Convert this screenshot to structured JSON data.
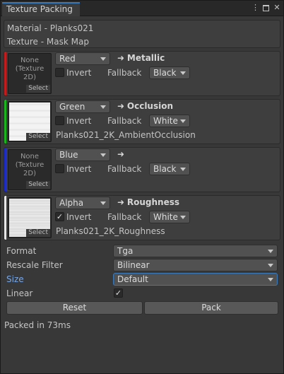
{
  "window": {
    "tab_title": "Texture Packing",
    "icons": [
      "kebab-menu-icon",
      "maximize-icon",
      "close-icon"
    ]
  },
  "info": {
    "material": "Material - Planks021",
    "texture": "Texture - Mask Map"
  },
  "channels": [
    {
      "strip_color": "#c41c1c",
      "slot_text": "None\n(Texture\n2D)",
      "slot_has_texture": false,
      "source": "Red",
      "target": "Metallic",
      "invert_label": "Invert",
      "invert_checked": false,
      "fallback_label": "Fallback",
      "fallback": "Black",
      "texture_name": ""
    },
    {
      "strip_color": "#1cb41c",
      "slot_text": "",
      "slot_has_texture": true,
      "source": "Green",
      "target": "Occlusion",
      "invert_label": "Invert",
      "invert_checked": false,
      "fallback_label": "Fallback",
      "fallback": "White",
      "texture_name": "Planks021_2K_AmbientOcclusion"
    },
    {
      "strip_color": "#1c2cc4",
      "slot_text": "None\n(Texture\n2D)",
      "slot_has_texture": false,
      "source": "Blue",
      "target": "",
      "invert_label": "Invert",
      "invert_checked": false,
      "fallback_label": "Fallback",
      "fallback": "Black",
      "texture_name": ""
    },
    {
      "strip_color": "#e6e6e6",
      "slot_text": "",
      "slot_has_texture": true,
      "source": "Alpha",
      "target": "Roughness",
      "invert_label": "Invert",
      "invert_checked": true,
      "fallback_label": "Fallback",
      "fallback": "White",
      "texture_name": "Planks021_2K_Roughness"
    }
  ],
  "slot_select_label": "Select",
  "arrow_glyph": "➜",
  "settings": {
    "format_label": "Format",
    "format_value": "Tga",
    "rescale_label": "Rescale Filter",
    "rescale_value": "Bilinear",
    "size_label": "Size",
    "size_value": "Default",
    "linear_label": "Linear",
    "linear_checked": true,
    "reset_label": "Reset",
    "pack_label": "Pack"
  },
  "status": "Packed in 73ms"
}
